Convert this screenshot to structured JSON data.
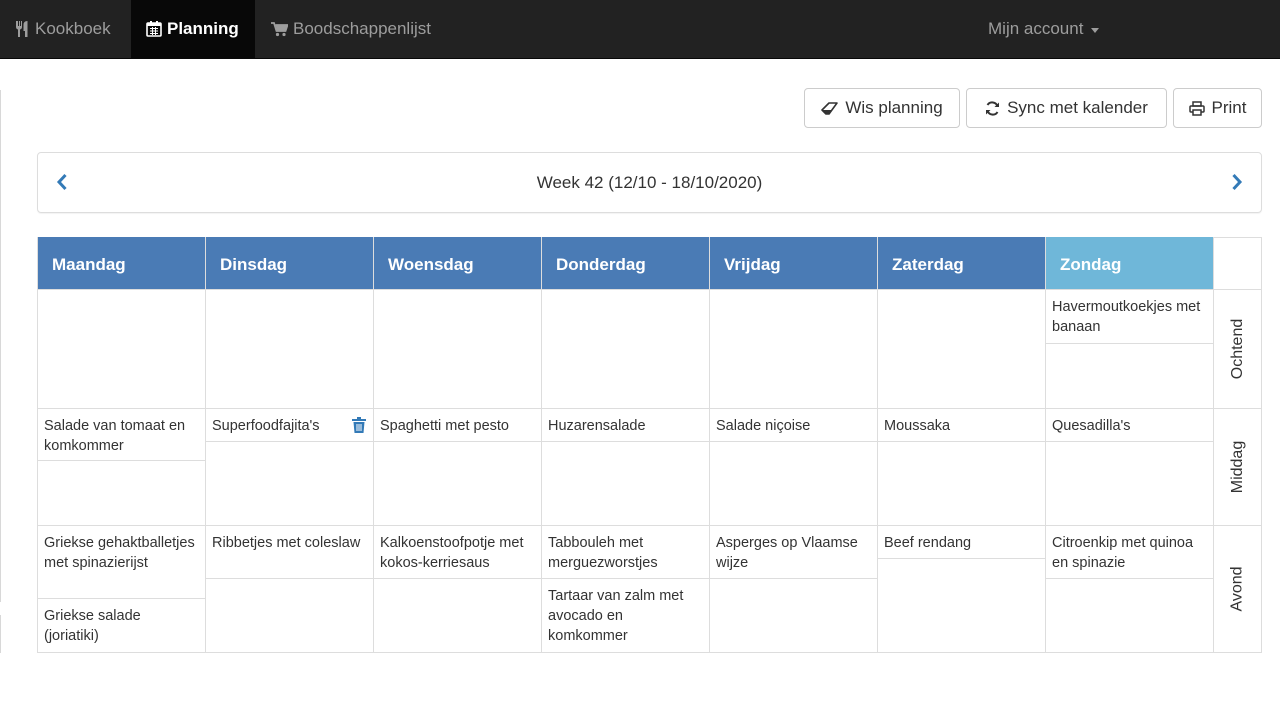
{
  "nav": {
    "cookbook": "Kookboek",
    "planning": "Planning",
    "shopping": "Boodschappenlijst",
    "account": "Mijn account"
  },
  "toolbar": {
    "clear": "Wis planning",
    "sync": "Sync met kalender",
    "print": "Print"
  },
  "week": {
    "label": "Week 42 (12/10 - 18/10/2020)"
  },
  "colors": {
    "header": "#4a7bb5",
    "today": "#6fb7d9",
    "nav": "#222222",
    "link": "#337ab7"
  },
  "days": [
    "Maandag",
    "Dinsdag",
    "Woensdag",
    "Donderdag",
    "Vrijdag",
    "Zaterdag",
    "Zondag"
  ],
  "slots": [
    "Ochtend",
    "Middag",
    "Avond"
  ],
  "meals": {
    "ochtend": {
      "zondag": [
        "Havermoutkoekjes met banaan"
      ]
    },
    "middag": {
      "maandag": [
        "Salade van tomaat en komkommer"
      ],
      "dinsdag": [
        "Superfoodfajita's"
      ],
      "woensdag": [
        "Spaghetti met pesto"
      ],
      "donderdag": [
        "Huzarensalade"
      ],
      "vrijdag": [
        "Salade niçoise"
      ],
      "zaterdag": [
        "Moussaka"
      ],
      "zondag": [
        "Quesadilla's"
      ]
    },
    "avond": {
      "maandag": [
        "Griekse gehaktballetjes met spinazierijst",
        "Griekse salade (joriatiki)"
      ],
      "dinsdag": [
        "Ribbetjes met coleslaw"
      ],
      "woensdag": [
        "Kalkoenstoofpotje met kokos-kerriesaus"
      ],
      "donderdag": [
        "Tabbouleh met merguezworstjes",
        "Tartaar van zalm met avocado en komkommer"
      ],
      "vrijdag": [
        "Asperges op Vlaamse wijze"
      ],
      "zaterdag": [
        "Beef rendang"
      ],
      "zondag": [
        "Citroenkip met quinoa en spinazie"
      ]
    }
  }
}
